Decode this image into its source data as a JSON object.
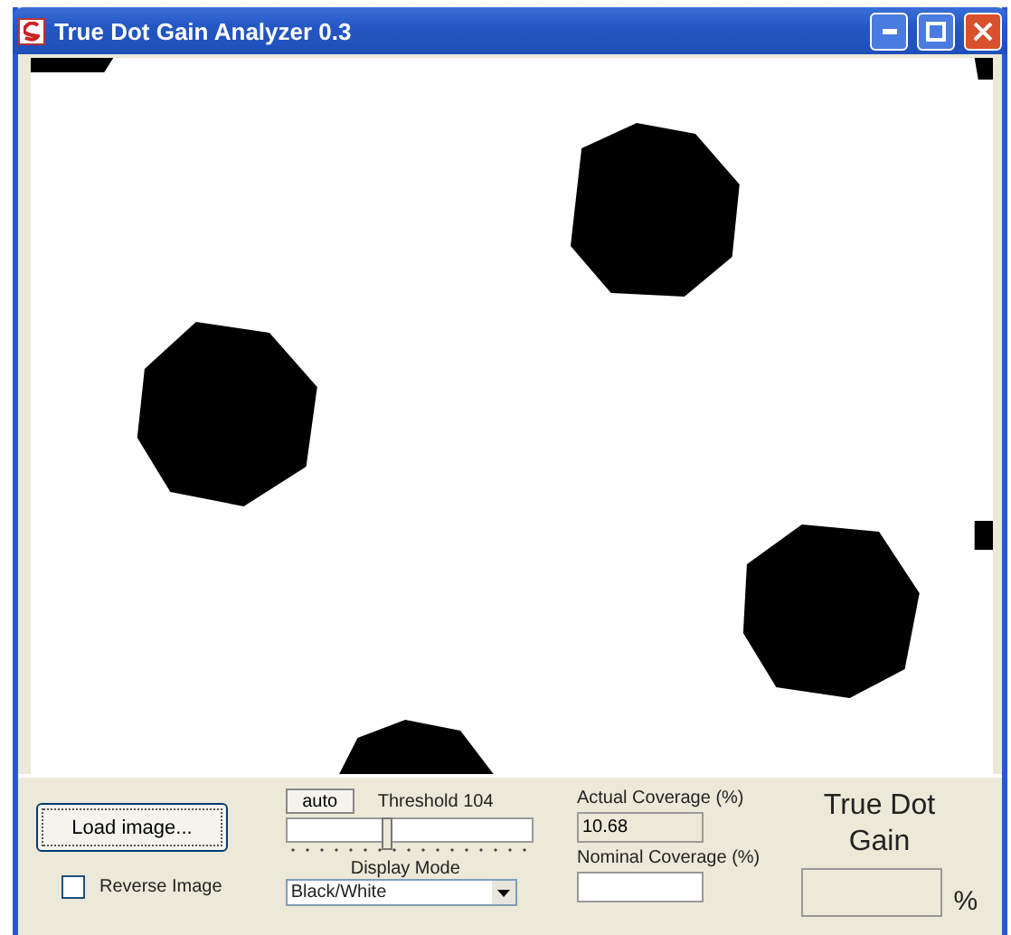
{
  "window": {
    "title": "True Dot Gain Analyzer 0.3"
  },
  "controls": {
    "load_button": "Load image...",
    "reverse_image": {
      "label": "Reverse Image",
      "checked": false
    },
    "auto_button": "auto",
    "threshold": {
      "label": "Threshold 104",
      "level": 0.41
    },
    "display_mode": {
      "label": "Display Mode",
      "value": "Black/White"
    },
    "actual_coverage": {
      "label": "Actual Coverage (%)",
      "value": "10.68"
    },
    "nominal_coverage": {
      "label": "Nominal Coverage (%)"
    },
    "true_dot_gain": {
      "label": "True Dot Gain",
      "unit": "%"
    }
  }
}
